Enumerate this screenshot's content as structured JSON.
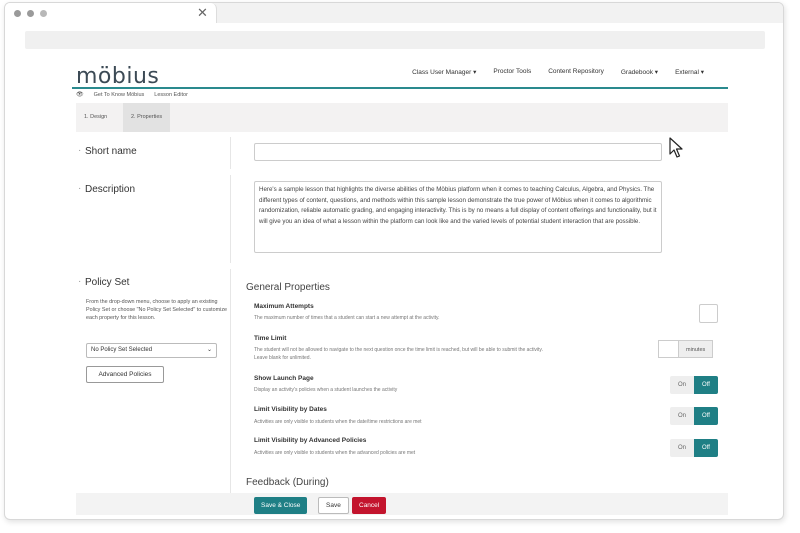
{
  "browser": {
    "close_glyph": "✕"
  },
  "header": {
    "logo": "möbius",
    "nav": [
      "Class User Manager ▾",
      "Proctor Tools",
      "Content Repository",
      "Gradebook ▾",
      "External ▾"
    ]
  },
  "breadcrumb": {
    "items": [
      "Get To Know Möbius",
      "Lesson Editor"
    ]
  },
  "subtabs": [
    "1. Design",
    "2. Properties"
  ],
  "form": {
    "short_name_label": "Short name",
    "short_name_value": "",
    "description_label": "Description",
    "description_value": "Here's a sample lesson that highlights the diverse abilities of the Möbius platform when it comes to teaching Calculus, Algebra, and Physics. The different types of content, questions, and methods within this sample lesson demonstrate the true power of Möbius when it comes to algorithmic randomization, reliable automatic grading, and engaging interactivity. This is by no means a full display of content offerings and functionality, but it will give you an idea of what a lesson within the platform can look like and the varied levels of potential student interaction that are possible.",
    "policy_set_label": "Policy Set",
    "policy_set_help": "From the drop-down menu, choose to apply an existing Policy Set or choose \"No Policy Set Selected\" to customize each property for this lesson.",
    "policy_select_value": "No Policy Set Selected",
    "advanced_policies_label": "Advanced Policies"
  },
  "general_properties": {
    "title": "General Properties",
    "items": [
      {
        "title": "Maximum Attempts",
        "desc": "The maximum number of times that a student can start a new attempt at the activity."
      },
      {
        "title": "Time Limit",
        "desc": "The student will not be allowed to navigate to the next question once the time limit is reached, but will be able to submit the activity. Leave blank for unlimited.",
        "unit": "minutes"
      },
      {
        "title": "Show Launch Page",
        "desc": "Display an activity's policies when a student launches the activity"
      },
      {
        "title": "Limit Visibility by Dates",
        "desc": "Activities are only visible to students when the date/time restrictions are met"
      },
      {
        "title": "Limit Visibility by Advanced Policies",
        "desc": "Activities are only visible to students when the advanced policies are met"
      }
    ],
    "toggle_on": "On",
    "toggle_off": "Off"
  },
  "feedback": {
    "title": "Feedback (During)"
  },
  "actions": {
    "save_close": "Save & Close",
    "save": "Save",
    "cancel": "Cancel"
  },
  "colors": {
    "accent": "#1f7f85",
    "cancel": "#c3142d"
  }
}
